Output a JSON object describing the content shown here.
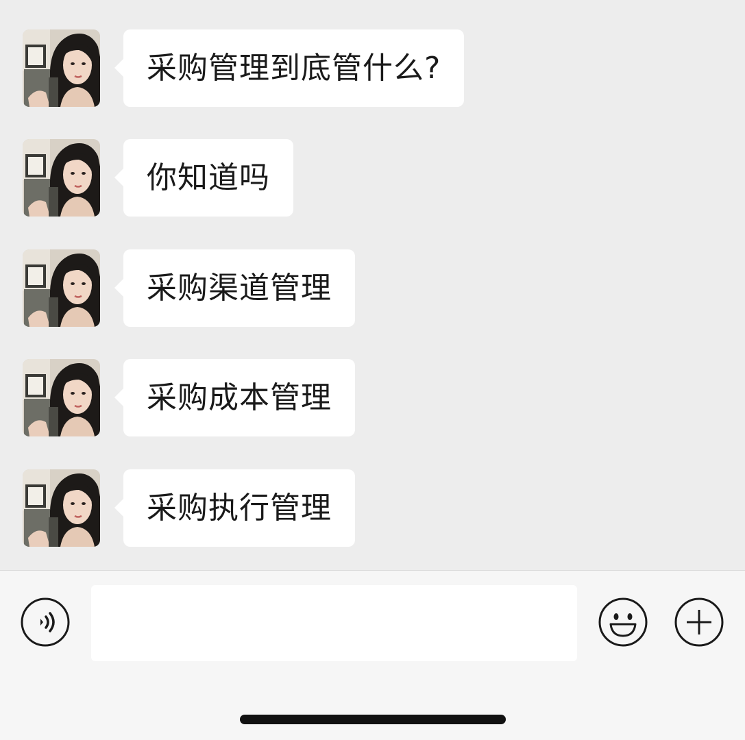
{
  "chat": {
    "messages": [
      {
        "text": "采购管理到底管什么?"
      },
      {
        "text": "你知道吗"
      },
      {
        "text": "采购渠道管理"
      },
      {
        "text": "采购成本管理"
      },
      {
        "text": "采购执行管理"
      }
    ]
  },
  "input_bar": {
    "message_value": "",
    "message_placeholder": "",
    "voice_icon": "voice-icon",
    "emoji_icon": "emoji-icon",
    "plus_icon": "plus-icon"
  },
  "colors": {
    "chat_background": "#ededed",
    "bubble": "#ffffff",
    "input_bar_background": "#f6f6f6",
    "text": "#1a1a1a"
  }
}
